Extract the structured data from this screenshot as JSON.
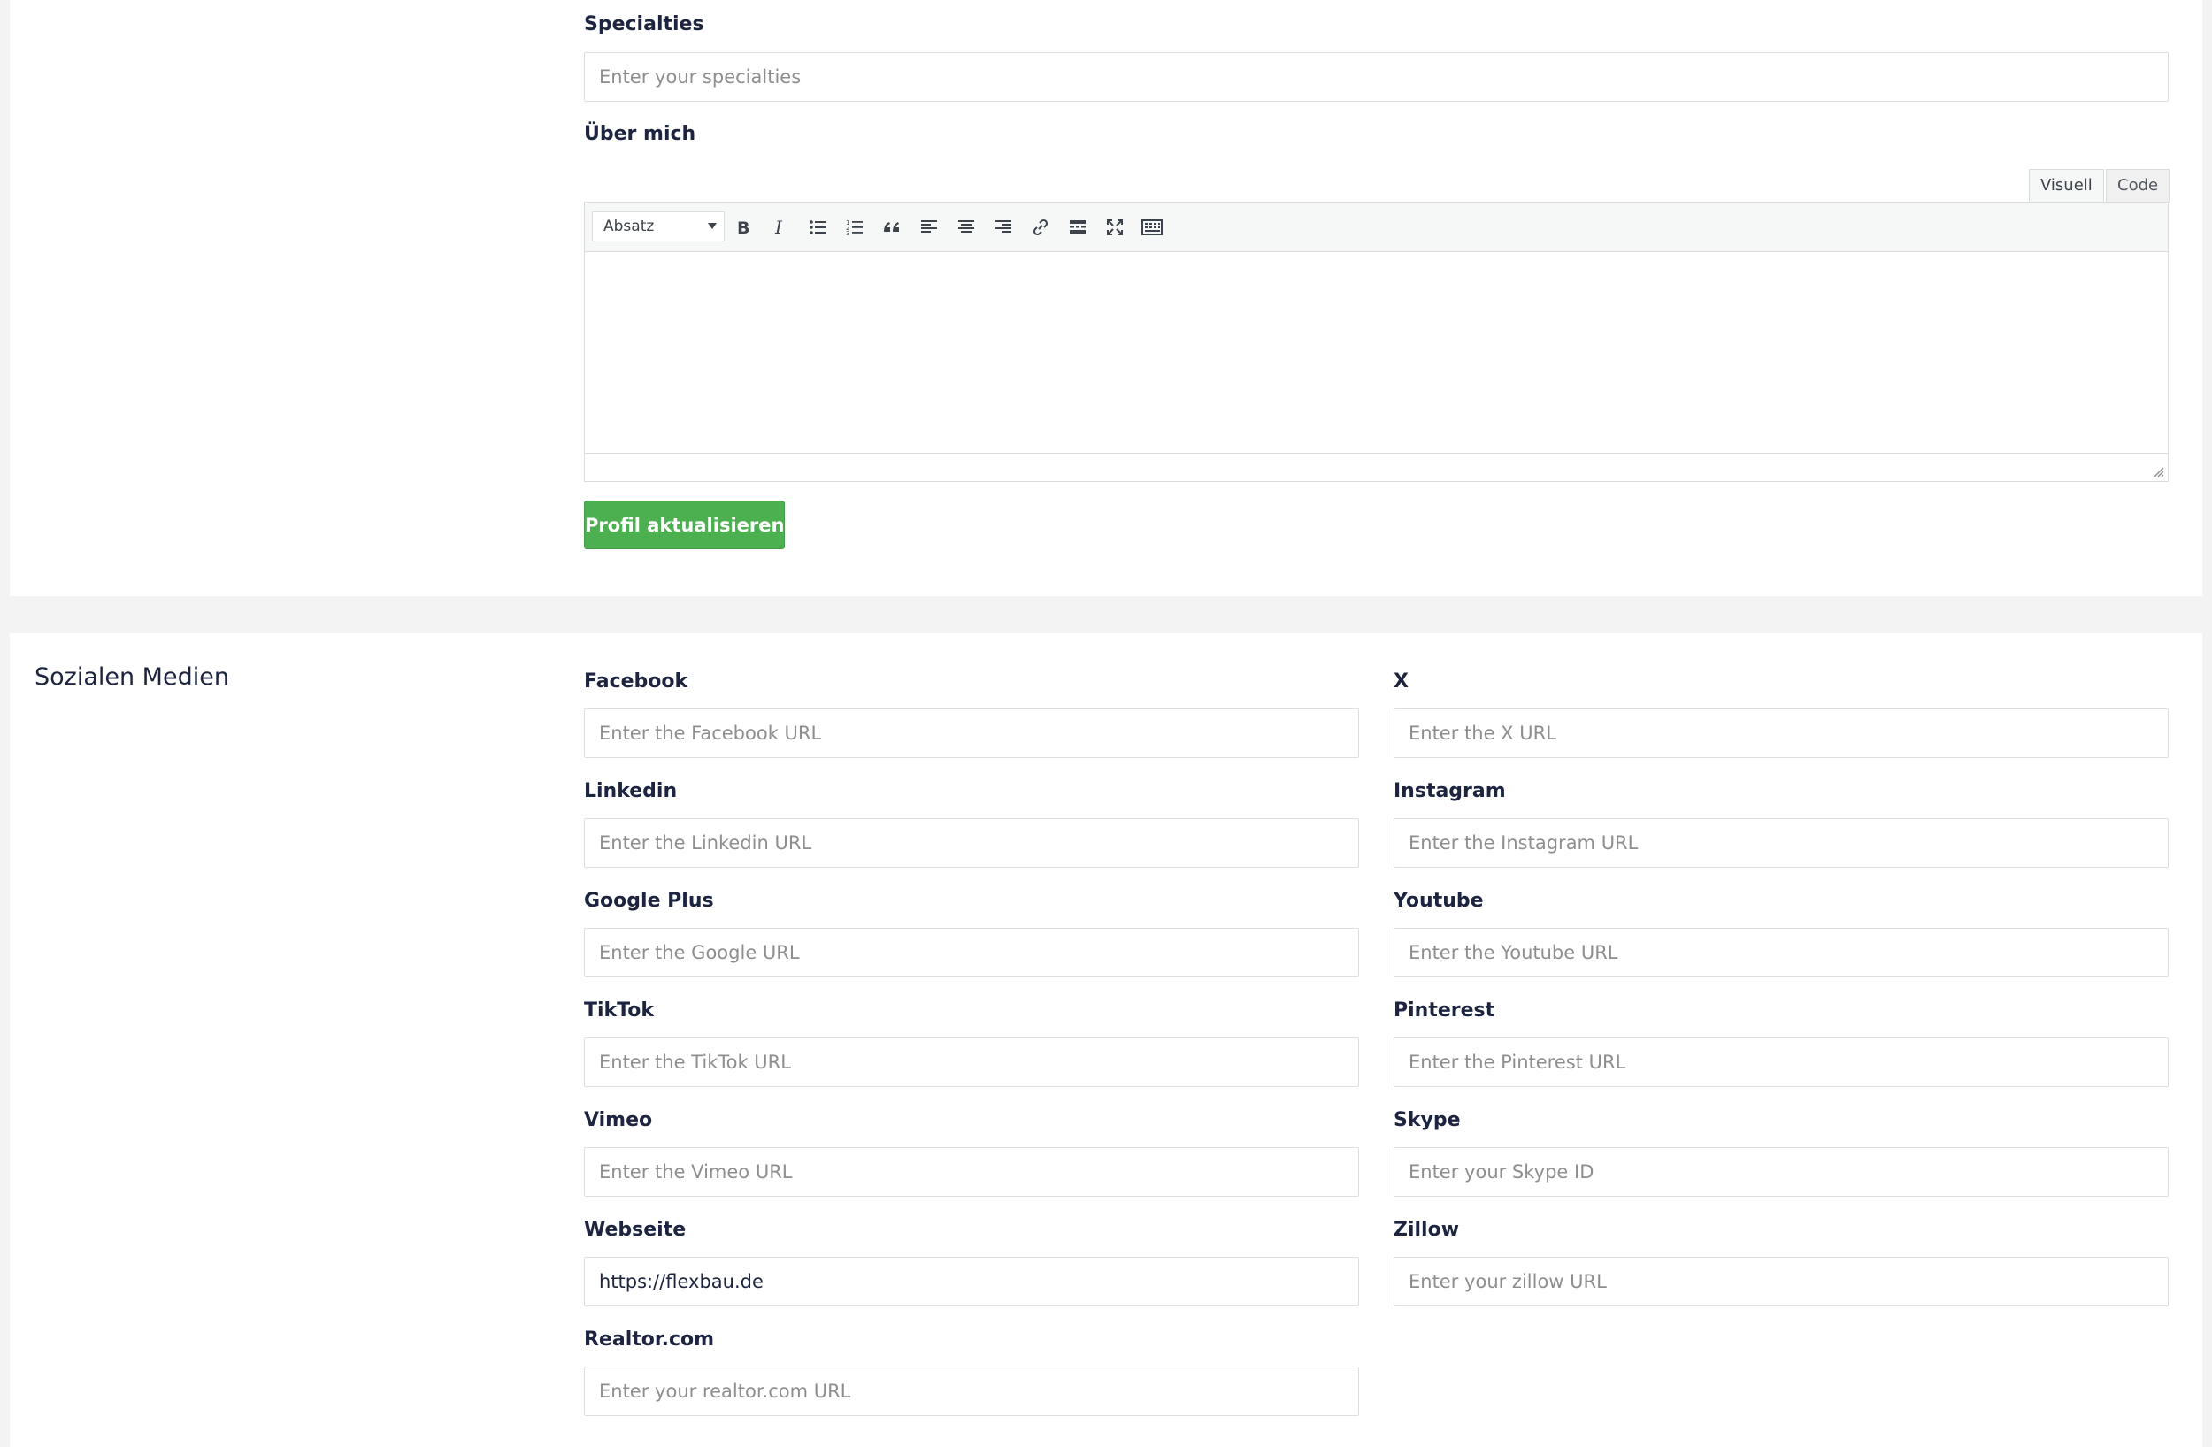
{
  "profile": {
    "specialties_label": "Specialties",
    "specialties_placeholder": "Enter your specialties",
    "about_label": "Über mich",
    "editor": {
      "tab_visual": "Visuell",
      "tab_code": "Code",
      "format_value": "Absatz",
      "toolbar_icons": [
        "bold-icon",
        "italic-icon",
        "bullet-list-icon",
        "numbered-list-icon",
        "blockquote-icon",
        "align-left-icon",
        "align-center-icon",
        "align-right-icon",
        "link-icon",
        "read-more-icon",
        "fullscreen-icon",
        "toolbar-toggle-icon"
      ]
    },
    "update_button": "Profil aktualisieren"
  },
  "social": {
    "title": "Sozialen Medien",
    "fields": {
      "facebook": {
        "label": "Facebook",
        "placeholder": "Enter the Facebook URL",
        "value": ""
      },
      "x": {
        "label": "X",
        "placeholder": "Enter the X URL",
        "value": ""
      },
      "linkedin": {
        "label": "Linkedin",
        "placeholder": "Enter the Linkedin URL",
        "value": ""
      },
      "instagram": {
        "label": "Instagram",
        "placeholder": "Enter the Instagram URL",
        "value": ""
      },
      "google": {
        "label": "Google Plus",
        "placeholder": "Enter the Google URL",
        "value": ""
      },
      "youtube": {
        "label": "Youtube",
        "placeholder": "Enter the Youtube URL",
        "value": ""
      },
      "tiktok": {
        "label": "TikTok",
        "placeholder": "Enter the TikTok URL",
        "value": ""
      },
      "pinterest": {
        "label": "Pinterest",
        "placeholder": "Enter the Pinterest URL",
        "value": ""
      },
      "vimeo": {
        "label": "Vimeo",
        "placeholder": "Enter the Vimeo URL",
        "value": ""
      },
      "skype": {
        "label": "Skype",
        "placeholder": "Enter your Skype ID",
        "value": ""
      },
      "website": {
        "label": "Webseite",
        "placeholder": "",
        "value": "https://flexbau.de"
      },
      "zillow": {
        "label": "Zillow",
        "placeholder": "Enter your zillow URL",
        "value": ""
      },
      "realtor": {
        "label": "Realtor.com",
        "placeholder": "Enter your realtor.com URL",
        "value": ""
      }
    }
  },
  "colors": {
    "primary_button": "#4caf50",
    "text": "#1c2440",
    "border": "#dedede",
    "page_bg": "#f3f3f3"
  }
}
